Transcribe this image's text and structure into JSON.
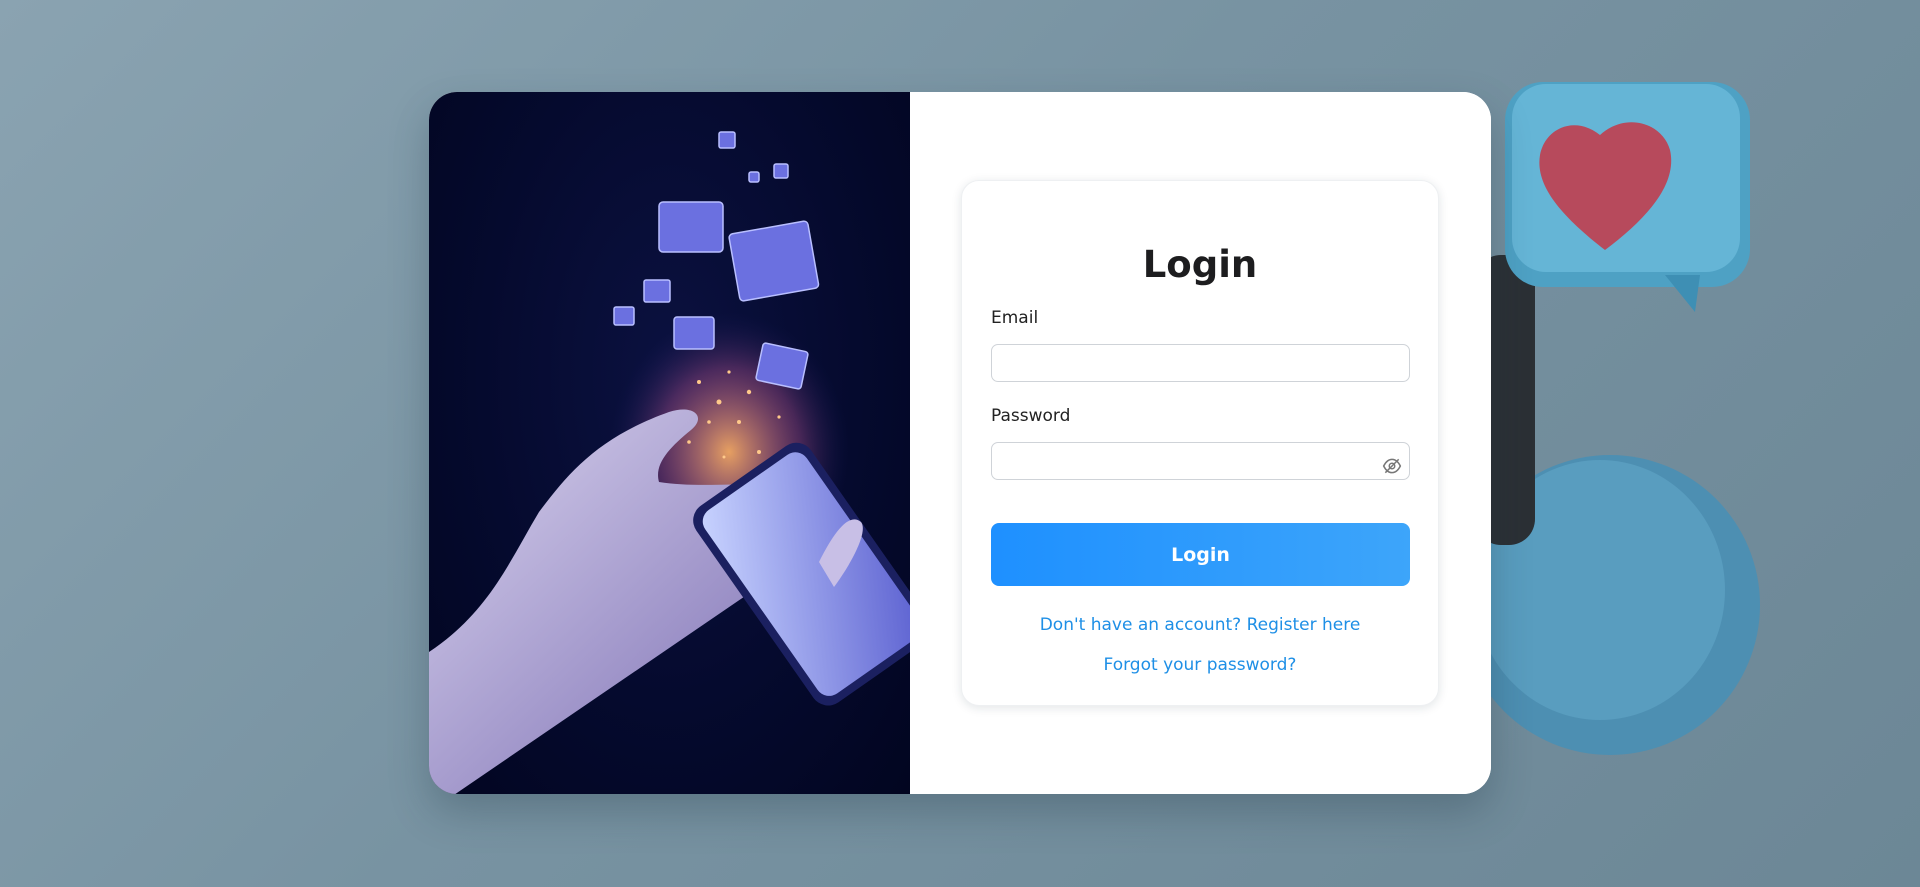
{
  "form": {
    "title": "Login",
    "email_label": "Email",
    "email_value": "",
    "password_label": "Password",
    "password_value": "",
    "submit_label": "Login",
    "register_link": "Don't have an account? Register here",
    "forgot_link": "Forgot your password?"
  },
  "icons": {
    "password_toggle": "eye-off-icon"
  },
  "colors": {
    "accent": "#1e90ff",
    "link": "#1e8fe6",
    "background": "#7b95a4",
    "hero_bg": "#050a2e"
  }
}
